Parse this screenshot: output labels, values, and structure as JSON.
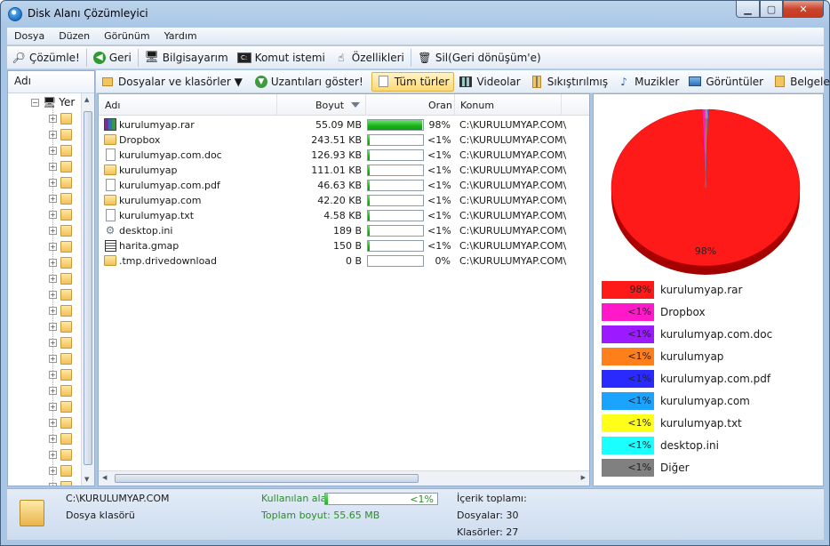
{
  "window": {
    "title": "Disk Alanı Çözümleyici"
  },
  "menu": [
    "Dosya",
    "Düzen",
    "Görünüm",
    "Yardım"
  ],
  "toolbar1": [
    {
      "label": "Çözümle!",
      "icon": "magnifier-icon"
    },
    {
      "label": "Geri",
      "icon": "back-arrow-icon"
    },
    {
      "label": "Bilgisayarım",
      "icon": "computer-icon"
    },
    {
      "label": "Komut istemi",
      "icon": "console-icon"
    },
    {
      "label": "Özellikleri",
      "icon": "properties-icon"
    },
    {
      "label": "Sil(Geri dönüşüm'e)",
      "icon": "recycle-bin-icon"
    }
  ],
  "toolbar2": [
    {
      "label": "Dosyalar ve klasörler ▼",
      "icon": "folders-icon"
    },
    {
      "label": "Uzantıları göster!",
      "icon": "extension-icon"
    },
    {
      "label": "Tüm türler",
      "icon": "all-types-icon",
      "active": true
    },
    {
      "label": "Videolar",
      "icon": "video-icon"
    },
    {
      "label": "Sıkıştırılmış",
      "icon": "zip-icon"
    },
    {
      "label": "Muzikler",
      "icon": "music-icon"
    },
    {
      "label": "Görüntüler",
      "icon": "image-icon"
    },
    {
      "label": "Belgeler",
      "icon": "document-icon"
    }
  ],
  "tree": {
    "header": "Adı",
    "root_label": "Yer",
    "child_count": 25
  },
  "list": {
    "columns": {
      "name": "Adı",
      "size": "Boyut",
      "ratio": "Oran",
      "location": "Konum"
    },
    "rows": [
      {
        "name": "kurulumyap.rar",
        "size": "55.09 MB",
        "pct": "98%",
        "fill": 0.98,
        "loc": "C:\\KURULUMYAP.COM\\",
        "icon": "rar"
      },
      {
        "name": "Dropbox",
        "size": "243.51 KB",
        "pct": "<1%",
        "fill": 0.04,
        "loc": "C:\\KURULUMYAP.COM\\",
        "icon": "folder"
      },
      {
        "name": "kurulumyap.com.doc",
        "size": "126.93 KB",
        "pct": "<1%",
        "fill": 0.04,
        "loc": "C:\\KURULUMYAP.COM\\",
        "icon": "doc"
      },
      {
        "name": "kurulumyap",
        "size": "111.01 KB",
        "pct": "<1%",
        "fill": 0.04,
        "loc": "C:\\KURULUMYAP.COM\\",
        "icon": "folder"
      },
      {
        "name": "kurulumyap.com.pdf",
        "size": "46.63 KB",
        "pct": "<1%",
        "fill": 0.04,
        "loc": "C:\\KURULUMYAP.COM\\",
        "icon": "doc"
      },
      {
        "name": "kurulumyap.com",
        "size": "42.20 KB",
        "pct": "<1%",
        "fill": 0.04,
        "loc": "C:\\KURULUMYAP.COM\\",
        "icon": "folder"
      },
      {
        "name": "kurulumyap.txt",
        "size": "4.58 KB",
        "pct": "<1%",
        "fill": 0.04,
        "loc": "C:\\KURULUMYAP.COM\\",
        "icon": "doc"
      },
      {
        "name": "desktop.ini",
        "size": "189 B",
        "pct": "<1%",
        "fill": 0.04,
        "loc": "C:\\KURULUMYAP.COM\\",
        "icon": "gear"
      },
      {
        "name": "harita.gmap",
        "size": "150 B",
        "pct": "<1%",
        "fill": 0.04,
        "loc": "C:\\KURULUMYAP.COM\\",
        "icon": "map"
      },
      {
        "name": ".tmp.drivedownload",
        "size": "0 B",
        "pct": "0%",
        "fill": 0,
        "loc": "C:\\KURULUMYAP.COM\\",
        "icon": "folder"
      }
    ]
  },
  "chart_data": {
    "type": "pie",
    "center_label": "98%",
    "slices": [
      {
        "label": "kurulumyap.rar",
        "pct_text": "98%",
        "value": 98.0,
        "color": "#ff1a1a"
      },
      {
        "label": "Dropbox",
        "pct_text": "<1%",
        "value": 0.43,
        "color": "#ff19c8"
      },
      {
        "label": "kurulumyap.com.doc",
        "pct_text": "<1%",
        "value": 0.22,
        "color": "#9b1aff"
      },
      {
        "label": "kurulumyap",
        "pct_text": "<1%",
        "value": 0.19,
        "color": "#ff7f1a"
      },
      {
        "label": "kurulumyap.com.pdf",
        "pct_text": "<1%",
        "value": 0.08,
        "color": "#2a2aff"
      },
      {
        "label": "kurulumyap.com",
        "pct_text": "<1%",
        "value": 0.07,
        "color": "#1aa3ff"
      },
      {
        "label": "kurulumyap.txt",
        "pct_text": "<1%",
        "value": 0.01,
        "color": "#ffff1a"
      },
      {
        "label": "desktop.ini",
        "pct_text": "<1%",
        "value": 0.005,
        "color": "#1affff"
      },
      {
        "label": "Diğer",
        "pct_text": "<1%",
        "value": 0.005,
        "color": "#808080"
      }
    ]
  },
  "status": {
    "path": "C:\\KURULUMYAP.COM",
    "type": "Dosya klasörü",
    "used_label": "Kullanılan alan:",
    "used_value": "<1%",
    "used_fill": 0.02,
    "total_label": "Toplam boyut: 55.65 MB",
    "content_label": "İçerik toplamı:",
    "files_label": "Dosyalar: 30",
    "folders_label": "Klasörler: 27"
  }
}
